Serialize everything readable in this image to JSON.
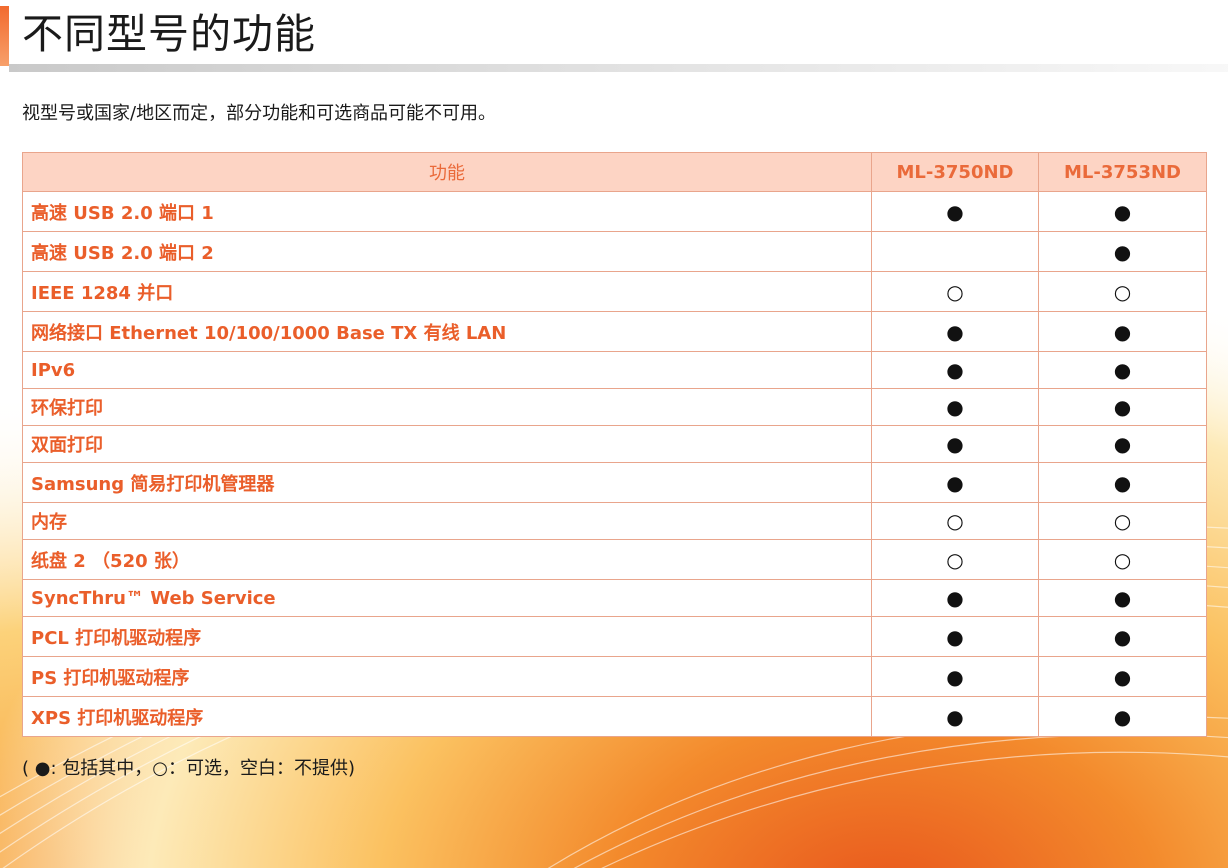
{
  "page": {
    "title": "不同型号的功能",
    "subtitle": "视型号或国家/地区而定，部分功能和可选商品可能不可用。",
    "legend": "( ●: 包括其中，○：可选，空白：不提供)"
  },
  "table": {
    "headers": [
      "功能",
      "ML-3750ND",
      "ML-3753ND"
    ],
    "rows": [
      {
        "feature": "高速 USB 2.0 端口 1",
        "ml3750nd": "●",
        "ml3753nd": "●"
      },
      {
        "feature": "高速 USB 2.0 端口 2",
        "ml3750nd": "",
        "ml3753nd": "●"
      },
      {
        "feature": "IEEE 1284 并口",
        "ml3750nd": "○",
        "ml3753nd": "○"
      },
      {
        "feature": "网络接口 Ethernet 10/100/1000 Base TX 有线 LAN",
        "ml3750nd": "●",
        "ml3753nd": "●"
      },
      {
        "feature": "IPv6",
        "ml3750nd": "●",
        "ml3753nd": "●"
      },
      {
        "feature": "环保打印",
        "ml3750nd": "●",
        "ml3753nd": "●"
      },
      {
        "feature": "双面打印",
        "ml3750nd": "●",
        "ml3753nd": "●"
      },
      {
        "feature": "Samsung 简易打印机管理器",
        "ml3750nd": "●",
        "ml3753nd": "●"
      },
      {
        "feature": "内存",
        "ml3750nd": "○",
        "ml3753nd": "○"
      },
      {
        "feature": "纸盘 2 （520 张）",
        "ml3750nd": "○",
        "ml3753nd": "○"
      },
      {
        "feature": "SyncThru™ Web Service",
        "ml3750nd": "●",
        "ml3753nd": "●"
      },
      {
        "feature": "PCL 打印机驱动程序",
        "ml3750nd": "●",
        "ml3753nd": "●"
      },
      {
        "feature": "PS 打印机驱动程序",
        "ml3750nd": "●",
        "ml3753nd": "●"
      },
      {
        "feature": "XPS 打印机驱动程序",
        "ml3750nd": "●",
        "ml3753nd": "●"
      }
    ]
  },
  "colors": {
    "accent": "#ea5e2a",
    "header_bg": "#fdd4c4",
    "border": "#e9a58c"
  }
}
